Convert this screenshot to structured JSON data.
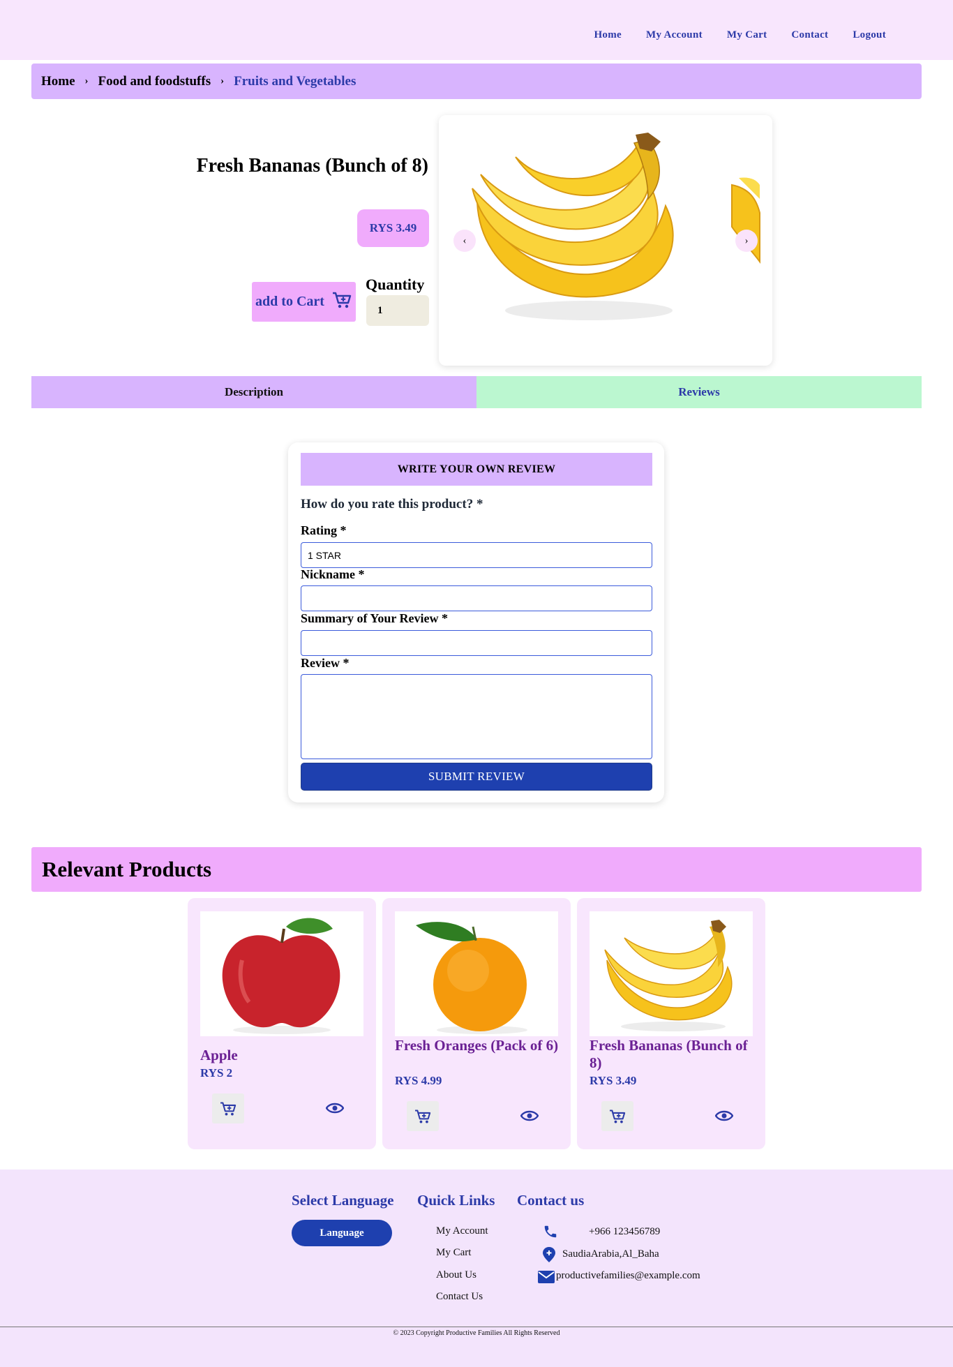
{
  "nav": {
    "items": [
      "Home",
      "My Account",
      "My Cart",
      "Contact",
      "Logout"
    ]
  },
  "breadcrumb": {
    "items": [
      "Home",
      "Food and foodstuffs",
      "Fruits and Vegetables"
    ]
  },
  "product": {
    "title": "Fresh Bananas (Bunch of 8)",
    "price": "RYS 3.49",
    "add_to_cart": "add to Cart",
    "quantity_label": "Quantity",
    "quantity_value": "1",
    "carousel_prev": "‹",
    "carousel_next": "›"
  },
  "tabs": {
    "description": "Description",
    "reviews": "Reviews"
  },
  "review_form": {
    "header": "WRITE YOUR OWN REVIEW",
    "question": "How do you rate this product? *",
    "rating_label": "Rating *",
    "rating_value": "1 STAR",
    "nickname_label": "Nickname *",
    "summary_label": "Summary of Your Review *",
    "review_label": "Review *",
    "submit": "SUBMIT REVIEW"
  },
  "relevant": {
    "heading": "Relevant Products",
    "products": [
      {
        "name": "Apple",
        "price": "RYS 2"
      },
      {
        "name": "Fresh Oranges (Pack of 6)",
        "price": "RYS 4.99"
      },
      {
        "name": "Fresh Bananas (Bunch of 8)",
        "price": "RYS 3.49"
      }
    ]
  },
  "footer": {
    "language_title": "Select Language",
    "language_button": "Language",
    "quick_links_title": "Quick Links",
    "quick_links": [
      "My Account",
      "My Cart",
      "About Us",
      "Contact Us"
    ],
    "contact_title": "Contact us",
    "phone": "+966 123456789",
    "address": "SaudiaArabia,Al_Baha",
    "email": "productivefamilies@example.com",
    "copyright": "© 2023 Copyright Productive Families All Rights Reserved"
  },
  "colors": {
    "accent_blue": "#2c3aa8",
    "button_blue": "#1e40af",
    "lavender": "#d8b4fe",
    "pink": "#f0abfc",
    "mint": "#bbf7d0"
  }
}
